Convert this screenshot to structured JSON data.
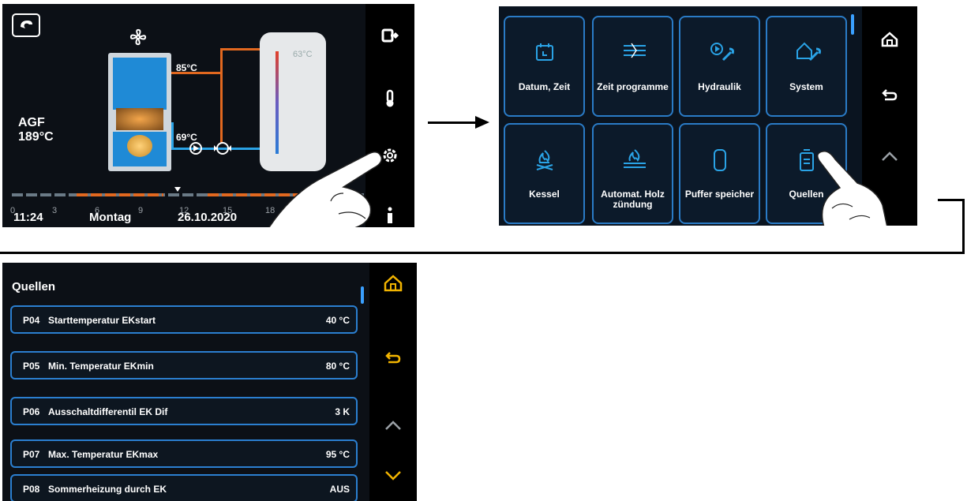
{
  "screen1": {
    "source_label": "AGF",
    "source_temp": "189°C",
    "supply_temp": "85°C",
    "return_temp": "69°C",
    "tank_temp": "63°C",
    "timeline_ticks": [
      "0",
      "3",
      "6",
      "9",
      "12",
      "15",
      "18"
    ],
    "time": "11:24",
    "weekday": "Montag",
    "date": "26.10.2020",
    "side_icons": [
      "exit-icon",
      "thermometer-icon",
      "gear-icon",
      "info-icon"
    ]
  },
  "screen2": {
    "tiles": [
      {
        "label": "Datum, Zeit",
        "icon": "calendar-icon"
      },
      {
        "label": "Zeit programme",
        "icon": "timeline-icon"
      },
      {
        "label": "Hydraulik",
        "icon": "pump-wrench-icon"
      },
      {
        "label": "System",
        "icon": "home-wrench-icon"
      },
      {
        "label": "Kessel",
        "icon": "flame-icon"
      },
      {
        "label": "Automat. Holz zündung",
        "icon": "ignition-icon"
      },
      {
        "label": "Puffer speicher",
        "icon": "tank-icon"
      },
      {
        "label": "Quellen",
        "icon": "source-icon"
      }
    ],
    "side_icons": [
      "home-icon",
      "back-icon",
      "chevron-up-icon"
    ]
  },
  "screen3": {
    "title": "Quellen",
    "rows": [
      {
        "code": "P04",
        "name": "Starttemperatur EKstart",
        "value": "40 °C"
      },
      {
        "code": "P05",
        "name": "Min. Temperatur EKmin",
        "value": "80 °C"
      },
      {
        "code": "P06",
        "name": "Ausschaltdifferentil EK Dif",
        "value": "3 K"
      },
      {
        "code": "P07",
        "name": "Max. Temperatur EKmax",
        "value": "95 °C"
      },
      {
        "code": "P08",
        "name": "Sommerheizung durch EK",
        "value": "AUS"
      }
    ],
    "side_icons": [
      "home-icon",
      "back-icon",
      "chevron-up-icon",
      "chevron-down-icon"
    ]
  },
  "colors": {
    "accent_blue": "#2b7fd0",
    "orange": "#e2681f",
    "side_yellow": "#f2b400"
  }
}
